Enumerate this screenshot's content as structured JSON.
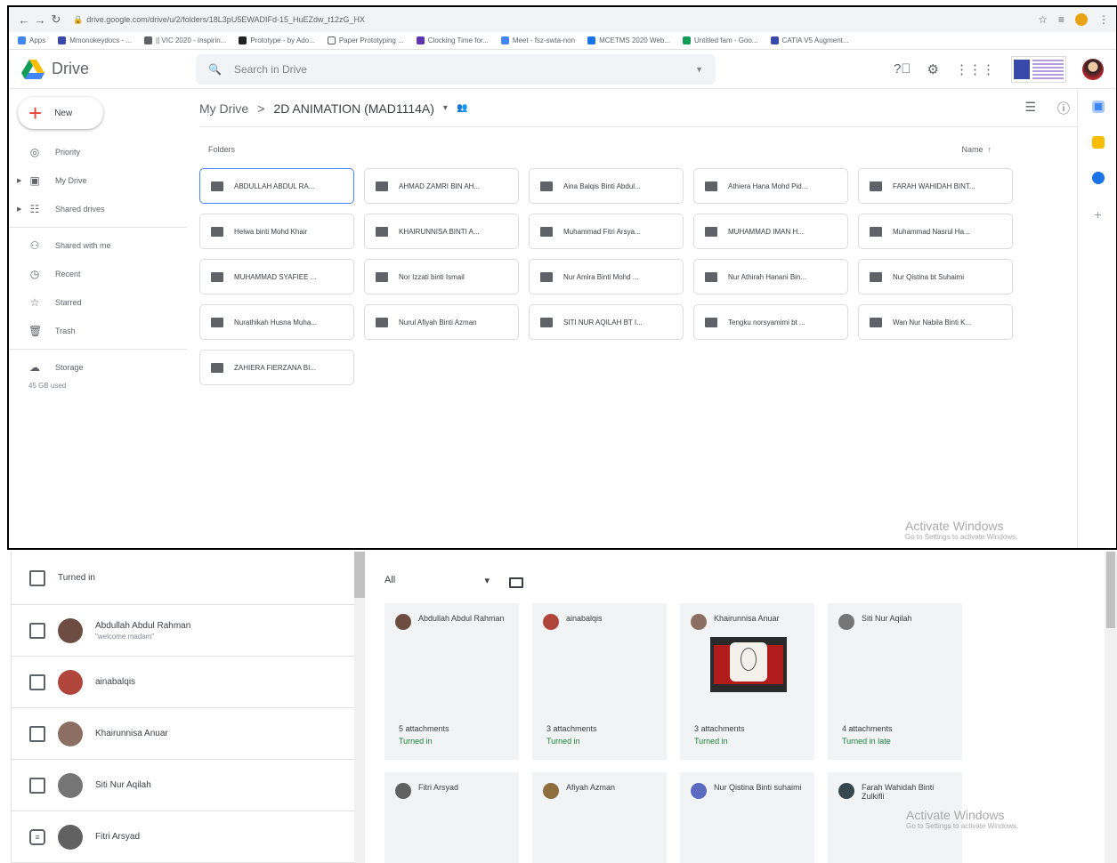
{
  "browser": {
    "url": "drive.google.com/drive/u/2/folders/18L3pU5EWADIFd-15_HuEZdw_t12zG_HX",
    "bookmarks": [
      {
        "label": "Apps",
        "color": "#4285f4"
      },
      {
        "label": "Mmonokeydocs - ...",
        "color": "#3949ab"
      },
      {
        "label": "|| VIC 2020 - Inspirin...",
        "color": "#5f6368"
      },
      {
        "label": "Prototype - by Ado...",
        "color": "#202124"
      },
      {
        "label": "Paper Prototyping ...",
        "color": "#ffffff"
      },
      {
        "label": "Clocking Time for...",
        "color": "#5e35b1"
      },
      {
        "label": "Meet - fsz-swta-non",
        "color": "#4285f4"
      },
      {
        "label": "MCETMS 2020 Web...",
        "color": "#1a73e8"
      },
      {
        "label": "Untitled fam - Goo...",
        "color": "#0f9d58"
      },
      {
        "label": "CATIA V5 Augment...",
        "color": "#3949ab"
      }
    ]
  },
  "drive": {
    "brand": "Drive",
    "search_placeholder": "Search in Drive",
    "new_label": "New",
    "sidebar": [
      {
        "label": "Priority",
        "icon": "check-circle-icon",
        "glyph": "◎",
        "caret": false
      },
      {
        "label": "My Drive",
        "icon": "my-drive-icon",
        "glyph": "▣",
        "caret": true
      },
      {
        "label": "Shared drives",
        "icon": "shared-drives-icon",
        "glyph": "☷",
        "caret": true
      },
      {
        "label": "Shared with me",
        "icon": "people-icon",
        "glyph": "⚇",
        "caret": false
      },
      {
        "label": "Recent",
        "icon": "clock-icon",
        "glyph": "◷",
        "caret": false
      },
      {
        "label": "Starred",
        "icon": "star-icon",
        "glyph": "☆",
        "caret": false
      },
      {
        "label": "Trash",
        "icon": "trash-icon",
        "glyph": "🗑",
        "caret": false
      }
    ],
    "storage_label": "Storage",
    "storage_used": "45 GB used",
    "breadcrumb": {
      "root": "My Drive",
      "separator": ">",
      "current": "2D ANIMATION (MAD1114A)"
    },
    "folders_label": "Folders",
    "sort_label": "Name",
    "folders": [
      "ABDULLAH ABDUL RA...",
      "AHMAD ZAMRI BIN AH...",
      "Aina Balqis Binti Abdul...",
      "Athiera Hana Mohd Pid...",
      "FARAH WAHIDAH BINT...",
      "Helwa binti Mohd Khair",
      "KHAIRUNNISA BINTI A...",
      "Muhammad Fitri Arsya...",
      "MUHAMMAD IMAN H...",
      "Muhammad Nasrul Ha...",
      "MUHAMMAD SYAFIEE ...",
      "Nor Izzati binti Ismail",
      "Nur Amira Binti Mohd ...",
      "Nur Athirah Hanani Bin...",
      "Nur Qistina bt Suhaimi",
      "Nurathikah Husna Muha...",
      "Nurul Afiyah Binti Azman",
      "SITI NUR AQILAH BT I...",
      "Tengku norsyamimi bt ...",
      "Wan Nur Nabila Binti K...",
      "ZAHIERA FIERZANA BI..."
    ],
    "activate_title": "Activate Windows",
    "activate_sub": "Go to Settings to activate Windows."
  },
  "classroom": {
    "header_label": "Turned in",
    "students": [
      {
        "name": "Abdullah Abdul Rahman",
        "comment": "\"welcome madam\"",
        "avatar": "#6d4c41"
      },
      {
        "name": "ainabalqis",
        "comment": "",
        "avatar": "#b0453b"
      },
      {
        "name": "Khairunnisa Anuar",
        "comment": "",
        "avatar": "#8d6e63"
      },
      {
        "name": "Siti Nur Aqilah",
        "comment": "",
        "avatar": "#757575"
      },
      {
        "name": "Fitri Arsyad",
        "comment": "",
        "avatar": "#616161"
      }
    ],
    "filter": "All",
    "cards": [
      {
        "name": "Abdullah Abdul Rahman",
        "attachments": "5 attachments",
        "status": "Turned in",
        "avatar": "#6d4c41",
        "thumb": false
      },
      {
        "name": "ainabalqis",
        "attachments": "3 attachments",
        "status": "Turned in",
        "avatar": "#b0453b",
        "thumb": false
      },
      {
        "name": "Khairunnisa Anuar",
        "attachments": "3 attachments",
        "status": "Turned in",
        "avatar": "#8d6e63",
        "thumb": true
      },
      {
        "name": "Siti Nur Aqilah",
        "attachments": "4 attachments",
        "status": "Turned in late",
        "avatar": "#757575",
        "thumb": false
      },
      {
        "name": "Fitri Arsyad",
        "attachments": "",
        "status": "",
        "avatar": "#616161",
        "thumb": false
      },
      {
        "name": "Afiyah Azman",
        "attachments": "",
        "status": "",
        "avatar": "#8d6e3c",
        "thumb": false
      },
      {
        "name": "Nur Qistina Binti suhaimi",
        "attachments": "",
        "status": "",
        "avatar": "#5c6bc0",
        "thumb": false
      },
      {
        "name": "Farah Wahidah Binti Zulkifli",
        "attachments": "",
        "status": "",
        "avatar": "#37474f",
        "thumb": false
      }
    ],
    "activate_title": "Activate Windows",
    "activate_sub": "Go to Settings to activate Windows."
  }
}
